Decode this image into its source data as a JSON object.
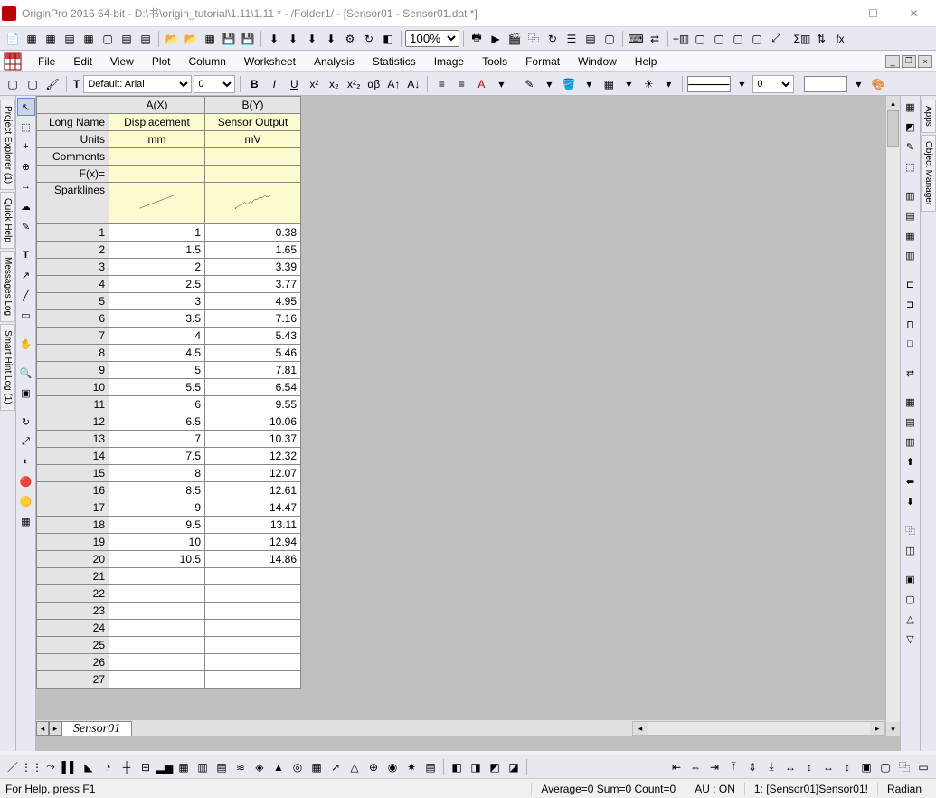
{
  "title": "OriginPro 2016 64-bit - D:\\书\\origin_tutorial\\1.11\\1.11 * - /Folder1/ - [Sensor01 - Sensor01.dat *]",
  "menus": [
    "File",
    "Edit",
    "View",
    "Plot",
    "Column",
    "Worksheet",
    "Analysis",
    "Statistics",
    "Image",
    "Tools",
    "Format",
    "Window",
    "Help"
  ],
  "zoom": "100%",
  "font": {
    "name": "Default: Arial",
    "size": "0"
  },
  "line_width_box": "0",
  "side_tabs_left": [
    "Project Explorer (1)",
    "Quick Help",
    "Messages Log",
    "Smart Hint Log (1)"
  ],
  "side_tabs_right": [
    "Apps",
    "Object Manager"
  ],
  "columns": {
    "a": {
      "header": "A(X)",
      "long_name": "Displacement",
      "units": "mm",
      "comments": "",
      "fx": ""
    },
    "b": {
      "header": "B(Y)",
      "long_name": "Sensor Output",
      "units": "mV",
      "comments": "",
      "fx": ""
    }
  },
  "row_labels": {
    "long_name": "Long Name",
    "units": "Units",
    "comments": "Comments",
    "fx": "F(x)=",
    "spark": "Sparklines"
  },
  "data": [
    {
      "n": 1,
      "a": "1",
      "b": "0.38"
    },
    {
      "n": 2,
      "a": "1.5",
      "b": "1.65"
    },
    {
      "n": 3,
      "a": "2",
      "b": "3.39"
    },
    {
      "n": 4,
      "a": "2.5",
      "b": "3.77"
    },
    {
      "n": 5,
      "a": "3",
      "b": "4.95"
    },
    {
      "n": 6,
      "a": "3.5",
      "b": "7.16"
    },
    {
      "n": 7,
      "a": "4",
      "b": "5.43"
    },
    {
      "n": 8,
      "a": "4.5",
      "b": "5.46"
    },
    {
      "n": 9,
      "a": "5",
      "b": "7.81"
    },
    {
      "n": 10,
      "a": "5.5",
      "b": "6.54"
    },
    {
      "n": 11,
      "a": "6",
      "b": "9.55"
    },
    {
      "n": 12,
      "a": "6.5",
      "b": "10.06"
    },
    {
      "n": 13,
      "a": "7",
      "b": "10.37"
    },
    {
      "n": 14,
      "a": "7.5",
      "b": "12.32"
    },
    {
      "n": 15,
      "a": "8",
      "b": "12.07"
    },
    {
      "n": 16,
      "a": "8.5",
      "b": "12.61"
    },
    {
      "n": 17,
      "a": "9",
      "b": "14.47"
    },
    {
      "n": 18,
      "a": "9.5",
      "b": "13.11"
    },
    {
      "n": 19,
      "a": "10",
      "b": "12.94"
    },
    {
      "n": 20,
      "a": "10.5",
      "b": "14.86"
    },
    {
      "n": 21,
      "a": "",
      "b": ""
    },
    {
      "n": 22,
      "a": "",
      "b": ""
    },
    {
      "n": 23,
      "a": "",
      "b": ""
    },
    {
      "n": 24,
      "a": "",
      "b": ""
    },
    {
      "n": 25,
      "a": "",
      "b": ""
    },
    {
      "n": 26,
      "a": "",
      "b": ""
    },
    {
      "n": 27,
      "a": "",
      "b": ""
    }
  ],
  "sheet_tab": "Sensor01",
  "status": {
    "help": "For Help, press F1",
    "stats": "Average=0 Sum=0 Count=0",
    "au": "AU : ON",
    "sel": "1: [Sensor01]Sensor01!",
    "angle": "Radian"
  },
  "chart_data": {
    "type": "line",
    "title": "",
    "xlabel": "Displacement (mm)",
    "ylabel": "Sensor Output (mV)",
    "series": [
      {
        "name": "A(X) Displacement",
        "values": [
          1,
          1.5,
          2,
          2.5,
          3,
          3.5,
          4,
          4.5,
          5,
          5.5,
          6,
          6.5,
          7,
          7.5,
          8,
          8.5,
          9,
          9.5,
          10,
          10.5
        ]
      },
      {
        "name": "B(Y) Sensor Output",
        "values": [
          0.38,
          1.65,
          3.39,
          3.77,
          4.95,
          7.16,
          5.43,
          5.46,
          7.81,
          6.54,
          9.55,
          10.06,
          10.37,
          12.32,
          12.07,
          12.61,
          14.47,
          13.11,
          12.94,
          14.86
        ]
      }
    ],
    "xlim": [
      1,
      10.5
    ],
    "ylim": [
      0,
      15
    ]
  }
}
